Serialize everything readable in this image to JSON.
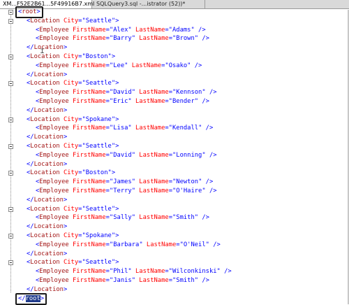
{
  "tabs": [
    {
      "label": "XM...F52E2B61...5F49916B7.xml"
    },
    {
      "label": "SQLQuery3.sql -...istrator (52))*"
    }
  ],
  "editor": {
    "root_open": "root",
    "root_close": "root",
    "locations": [
      {
        "city": "Seattle",
        "employees": [
          {
            "first": "Alex",
            "last": "Adams"
          },
          {
            "first": "Barry",
            "last": "Brown"
          }
        ]
      },
      {
        "city": "Boston",
        "employees": [
          {
            "first": "Lee",
            "last": "Osako"
          }
        ]
      },
      {
        "city": "Seattle",
        "employees": [
          {
            "first": "David",
            "last": "Kennson"
          },
          {
            "first": "Eric",
            "last": "Bender"
          }
        ]
      },
      {
        "city": "Spokane",
        "employees": [
          {
            "first": "Lisa",
            "last": "Kendall"
          }
        ]
      },
      {
        "city": "Seattle",
        "employees": [
          {
            "first": "David",
            "last": "Lonning"
          }
        ]
      },
      {
        "city": "Boston",
        "employees": [
          {
            "first": "James",
            "last": "Newton"
          },
          {
            "first": "Terry",
            "last": "O'Haire"
          }
        ]
      },
      {
        "city": "Seattle",
        "employees": [
          {
            "first": "Sally",
            "last": "Smith"
          }
        ]
      },
      {
        "city": "Spokane",
        "employees": [
          {
            "first": "Barbara",
            "last": "O'Neil"
          }
        ]
      },
      {
        "city": "Seattle",
        "employees": [
          {
            "first": "Phil",
            "last": "Wilconkinski"
          },
          {
            "first": "Janis",
            "last": "Smith"
          }
        ]
      }
    ]
  },
  "colors": {
    "tag_bracket": "#0000ff",
    "element_name": "#a31515",
    "attribute_name": "#ff0000",
    "attribute_value": "#0000ff",
    "selection": "#1f3a8a"
  }
}
